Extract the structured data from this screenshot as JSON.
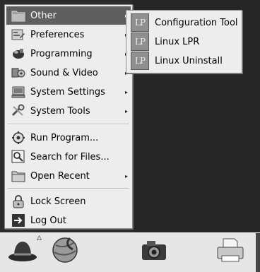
{
  "main_menu": {
    "items": [
      {
        "label": "Other",
        "icon": "other-folder-icon",
        "has_submenu": true
      },
      {
        "label": "Preferences",
        "icon": "preferences-icon",
        "has_submenu": true
      },
      {
        "label": "Programming",
        "icon": "programming-icon",
        "has_submenu": true
      },
      {
        "label": "Sound & Video",
        "icon": "sound-video-icon",
        "has_submenu": true
      },
      {
        "label": "System Settings",
        "icon": "system-settings-icon",
        "has_submenu": true
      },
      {
        "label": "System Tools",
        "icon": "system-tools-icon",
        "has_submenu": true
      },
      {
        "label": "Run Program...",
        "icon": "run-program-icon",
        "has_submenu": false
      },
      {
        "label": "Search for Files...",
        "icon": "search-files-icon",
        "has_submenu": false
      },
      {
        "label": "Open Recent",
        "icon": "open-recent-folder-icon",
        "has_submenu": true
      },
      {
        "label": "Lock Screen",
        "icon": "lock-icon",
        "has_submenu": false
      },
      {
        "label": "Log Out",
        "icon": "log-out-icon",
        "has_submenu": false
      }
    ],
    "submenu_arrow": "▸"
  },
  "sub_menu": {
    "items": [
      {
        "label": "Configuration Tool",
        "icon_text": "LP"
      },
      {
        "label": "Linux LPR",
        "icon_text": "LP"
      },
      {
        "label": "Linux Uninstall",
        "icon_text": "LP"
      }
    ]
  },
  "panel": {
    "launchers": [
      "red-hat-main-menu-icon",
      "web-browser-icon",
      "camera-icon",
      "printer-icon"
    ],
    "menu_indicator": "△"
  },
  "colors": {
    "menu_bg": "#ededed",
    "selected_bg": "#5f5f5f",
    "desktop_bg": "#262626",
    "panel_bg": "#e6e6e6"
  }
}
